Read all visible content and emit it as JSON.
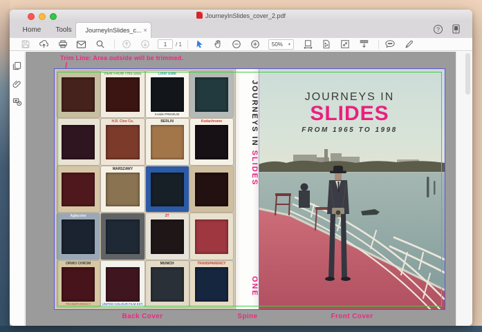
{
  "window": {
    "title": "JourneyInSlides_cover_2.pdf"
  },
  "tabs": {
    "home": "Home",
    "tools": "Tools",
    "document": "JourneyInSlides_c...",
    "close_glyph": "×"
  },
  "toolbar": {
    "page_current": "1",
    "page_total_label": "/ 1",
    "zoom_level": "50%",
    "zoom_caret": "▾"
  },
  "icons": {
    "help_glyph": "?"
  },
  "annotation": {
    "trim_note": "Trim Line: Area outside will be trimmed."
  },
  "page_labels": {
    "back_cover": "Back Cover",
    "spine": "Spine",
    "front_cover": "Front Cover"
  },
  "spine": {
    "title_black": "JOURNEYS IN ",
    "title_pink": "SLIDES",
    "volume": "ONE"
  },
  "front_cover": {
    "title_line1": "JOURNEYS IN",
    "title_line2": "SLIDES",
    "subtitle": "FROM 1965 TO 1998"
  },
  "colors": {
    "accent_pink": "#ed2882",
    "trim_line_green": "#3fd043",
    "page_border_blue": "#5b55d8",
    "fold_line_purple": "#8a7ad0",
    "doc_background_gray": "#9b9b9b"
  },
  "back_cover": {
    "slides": [
      {
        "mount": "#c8bfa2",
        "photo": "#45221b",
        "top": "",
        "top_color": "#2aa9a2",
        "bottom": "",
        "bottom_color": "#2aa9a2"
      },
      {
        "mount": "#f1ecdf",
        "photo": "#3a1511",
        "top": "VIEW FROM THIS SIDE",
        "top_color": "#8b8b7f",
        "bottom": "",
        "bottom_color": "#8b8b7f"
      },
      {
        "mount": "#f8f6ef",
        "photo": "#12161a",
        "top": "Color Slide",
        "top_color": "#2e8fd8",
        "bottom": "Kodak PREMIUM",
        "bottom_color": "#3a3a3a"
      },
      {
        "mount": "#b5b9b7",
        "photo": "#22393d",
        "top": "",
        "top_color": "#666",
        "bottom": "",
        "bottom_color": "#666"
      },
      {
        "mount": "#e9e3d4",
        "photo": "#2f1520",
        "top": "",
        "top_color": "#777",
        "bottom": "",
        "bottom_color": "#777"
      },
      {
        "mount": "#efe5d8",
        "photo": "#7b3a2a",
        "top": "H.R. Cine Co.",
        "top_color": "#c4473c",
        "bottom": "",
        "bottom_color": "#c4473c"
      },
      {
        "mount": "#f3efe3",
        "photo": "#a3764a",
        "top": "BERLIN",
        "top_color": "#3a3a3a",
        "bottom": "",
        "bottom_color": "#3a3a3a"
      },
      {
        "mount": "#f5f1e7",
        "photo": "#171015",
        "top": "Kodachrome",
        "top_color": "#d2382e",
        "bottom": "",
        "bottom_color": "#d2382e"
      },
      {
        "mount": "#d6c6a6",
        "photo": "#4f181c",
        "top": "",
        "top_color": "#b04038",
        "bottom": "",
        "bottom_color": "#b04038"
      },
      {
        "mount": "#f5f1e5",
        "photo": "#8a7350",
        "top": "WARSZAWY",
        "top_color": "#2a2a2a",
        "bottom": "",
        "bottom_color": "#2a2a2a"
      },
      {
        "mount": "#2b5aa6",
        "photo": "#171f27",
        "top": "",
        "top_color": "#cdd8e8",
        "bottom": "",
        "bottom_color": "#cdd8e8"
      },
      {
        "mount": "#cfbea0",
        "photo": "#231010",
        "top": "",
        "top_color": "#b04038",
        "bottom": "",
        "bottom_color": "#2a7dbb"
      },
      {
        "mount": "#9aa7b6",
        "photo": "#1b2330",
        "top": "Agfacolor",
        "top_color": "#f2f2f0",
        "bottom": "",
        "bottom_color": "#f2f2f0"
      },
      {
        "mount": "#5f6366",
        "photo": "#1f2936",
        "top": "",
        "top_color": "#ccc",
        "bottom": "",
        "bottom_color": "#ccc"
      },
      {
        "mount": "#e7e3d9",
        "photo": "#1f1717",
        "top": "2T",
        "top_color": "#cc2a2a",
        "bottom": "",
        "bottom_color": "#cc2a2a"
      },
      {
        "mount": "#eae0ce",
        "photo": "#9e3740",
        "top": "",
        "top_color": "#888",
        "bottom": "",
        "bottom_color": "#888"
      },
      {
        "mount": "#d7c7a3",
        "photo": "#46141a",
        "top": "ORWO CHROM",
        "top_color": "#3a3a3a",
        "bottom": "TRANSPARENCY",
        "bottom_color": "#a05a2d"
      },
      {
        "mount": "#f1f1ed",
        "photo": "#3f161f",
        "top": "",
        "top_color": "#2a5cc0",
        "bottom": "UNITED COLOUR FILM EST.",
        "bottom_color": "#2a5cc0"
      },
      {
        "mount": "#e3dbc7",
        "photo": "#2a3038",
        "top": "MUNICH",
        "top_color": "#2a2a2a",
        "bottom": "",
        "bottom_color": "#2a2a2a"
      },
      {
        "mount": "#e7dbc3",
        "photo": "#16263e",
        "top": "TRANSPARENCY",
        "top_color": "#cc3a3a",
        "bottom": "",
        "bottom_color": "#cc3a3a"
      }
    ]
  }
}
